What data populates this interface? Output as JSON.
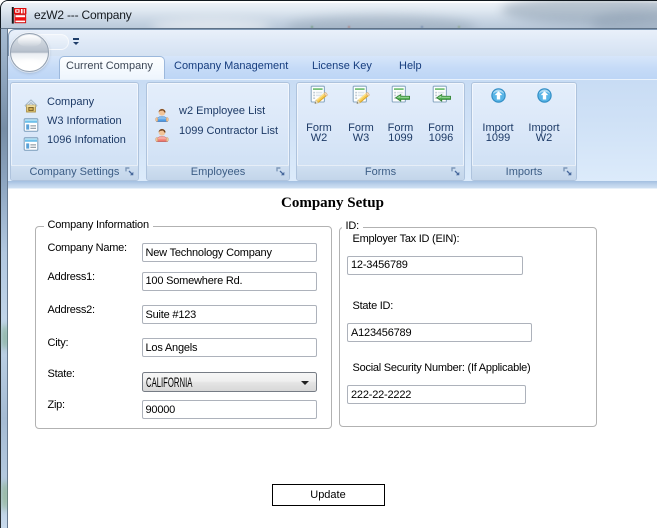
{
  "window": {
    "title": "ezW2 --- Company"
  },
  "colors": {
    "app_icon_red": "#e00b0b",
    "tab_text_blue": "#163d7e",
    "ribbon_item_text": "#1d3a66",
    "group_caption_text": "#3c5d85",
    "ribbon_background": "#cfe1f6",
    "titlebar_glass": "#c9d6e4",
    "content_background": "#ffffff"
  },
  "tabs": [
    {
      "label": "Current Company",
      "active": true
    },
    {
      "label": "Company Management",
      "active": false
    },
    {
      "label": "License Key",
      "active": false
    },
    {
      "label": "Help",
      "active": false
    }
  ],
  "ribbon": {
    "groups": [
      {
        "title": "Company Settings",
        "items": [
          {
            "label": "Company",
            "icon": "house-icon"
          },
          {
            "label": "W3 Information",
            "icon": "form-window-icon"
          },
          {
            "label": "1096 Infomation",
            "icon": "form-window-icon"
          }
        ]
      },
      {
        "title": "Employees",
        "items": [
          {
            "label": "w2 Employee List",
            "icon": "person-blue-icon"
          },
          {
            "label": "1099 Contractor List",
            "icon": "person-red-icon"
          }
        ]
      },
      {
        "title": "Forms",
        "items": [
          {
            "label": "Form W2",
            "line1": "Form",
            "line2": "W2",
            "icon": "form-edit-icon"
          },
          {
            "label": "Form W3",
            "line1": "Form",
            "line2": "W3",
            "icon": "form-edit-icon"
          },
          {
            "label": "Form 1099",
            "line1": "Form",
            "line2": "1099",
            "icon": "form-export-icon"
          },
          {
            "label": "Form 1096",
            "line1": "Form",
            "line2": "1096",
            "icon": "form-export-icon"
          }
        ]
      },
      {
        "title": "Imports",
        "items": [
          {
            "label": "Import 1099",
            "line1": "Import",
            "line2": "1099",
            "icon": "import-icon"
          },
          {
            "label": "Import W2",
            "line1": "Import",
            "line2": "W2",
            "icon": "import-icon"
          }
        ]
      }
    ]
  },
  "content": {
    "title": "Company Setup",
    "company_info": {
      "legend": "Company Information",
      "fields": [
        {
          "label": "Company Name:",
          "value": "New Technology Company"
        },
        {
          "label": "Address1:",
          "value": "100 Somewhere Rd."
        },
        {
          "label": "Address2:",
          "value": "Suite #123"
        },
        {
          "label": "City:",
          "value": "Los Angels"
        },
        {
          "label": "State:",
          "value": "CALIFORNIA"
        },
        {
          "label": "Zip:",
          "value": "90000"
        }
      ]
    },
    "id_section": {
      "legend": "ID:",
      "fields": [
        {
          "label": "Employer Tax ID (EIN):",
          "value": "12-3456789"
        },
        {
          "label": "State ID:",
          "value": "A123456789"
        },
        {
          "label": "Social Security Number: (If Applicable)",
          "value": "222-22-2222"
        }
      ]
    },
    "update_button": "Update"
  }
}
